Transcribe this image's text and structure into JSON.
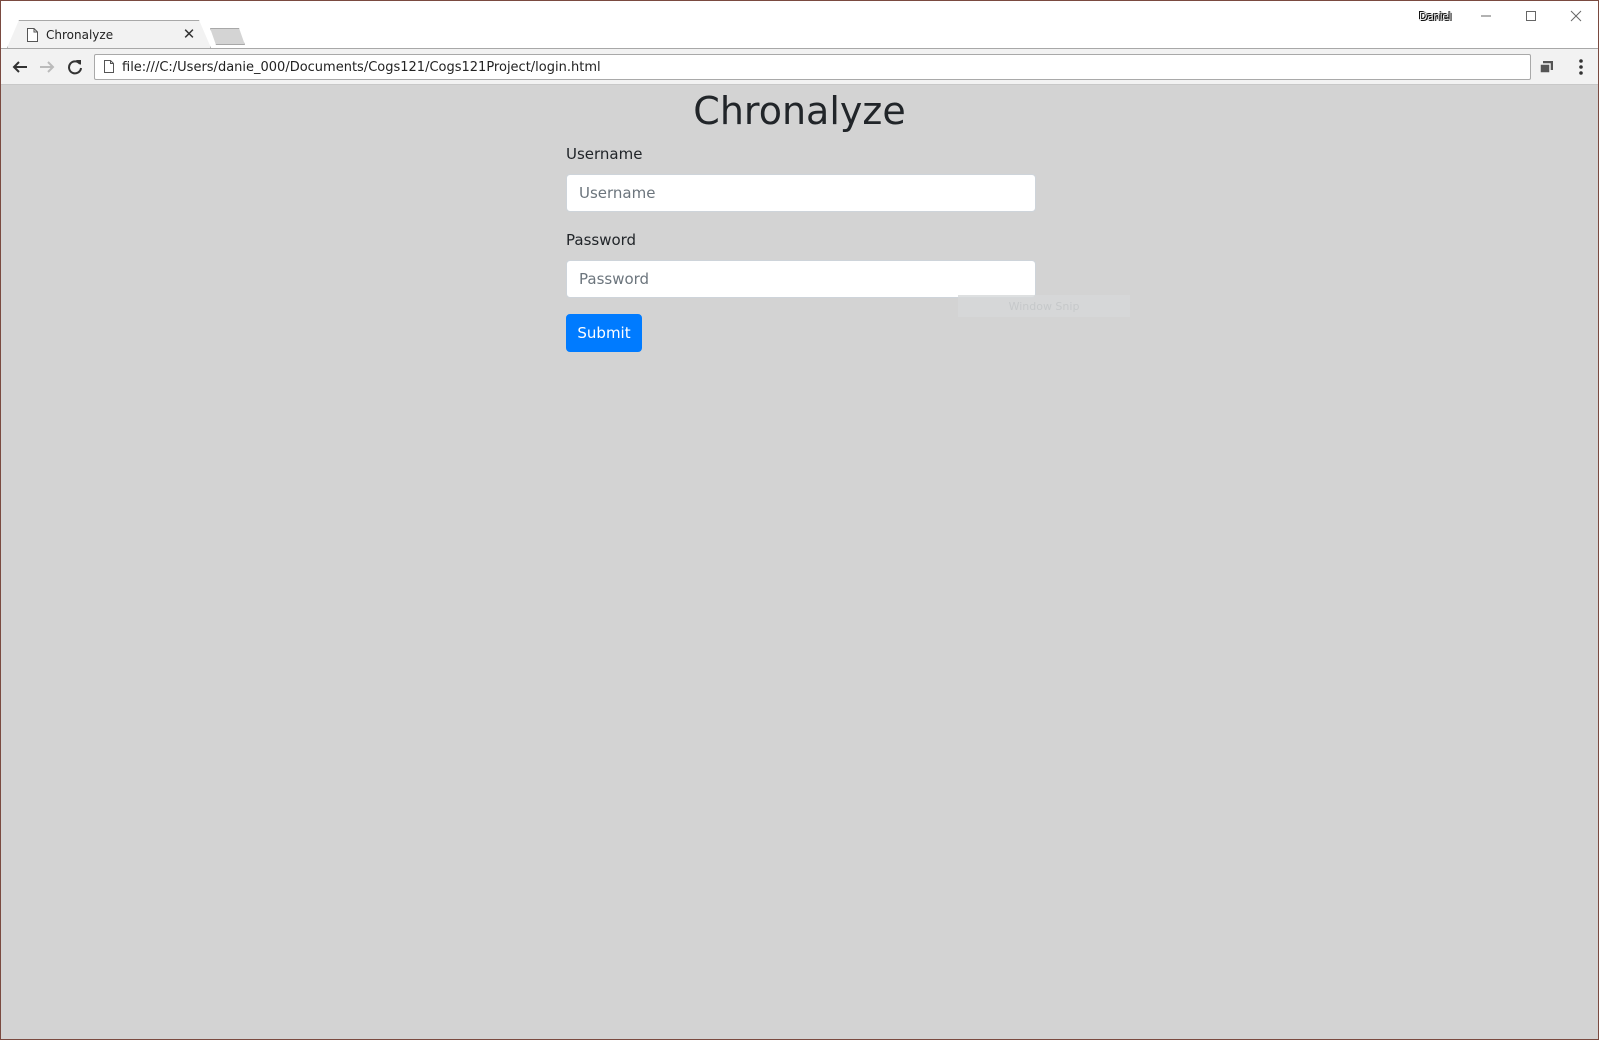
{
  "browser": {
    "tab": {
      "title": "Chronalyze"
    },
    "profile_name": "Daniel",
    "address_bar": {
      "url": "file:///C:/Users/danie_000/Documents/Cogs121/Cogs121Project/login.html"
    }
  },
  "page": {
    "title": "Chronalyze",
    "form": {
      "username": {
        "label": "Username",
        "placeholder": "Username",
        "value": ""
      },
      "password": {
        "label": "Password",
        "placeholder": "Password",
        "value": ""
      },
      "submit_label": "Submit"
    },
    "overlay_text": "Window Snip"
  },
  "colors": {
    "page_background": "#d3d3d3",
    "submit_button": "#007bff",
    "title_text": "#212529"
  },
  "icons": {
    "tab": "page-icon",
    "tab_close": "close-icon",
    "back": "arrow-left-icon",
    "forward": "arrow-right-icon",
    "reload": "reload-icon",
    "omnibox": "page-icon",
    "extension": "cast-icon",
    "menu": "kebab-menu-icon"
  }
}
